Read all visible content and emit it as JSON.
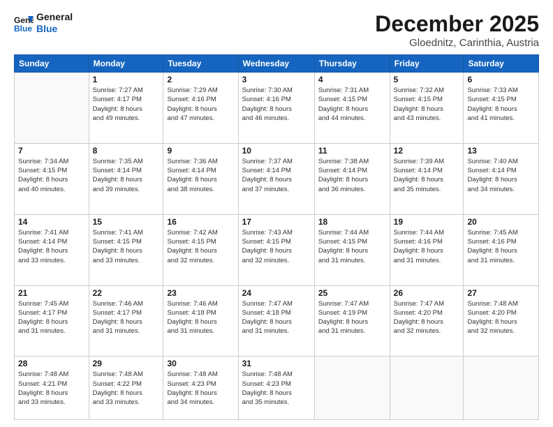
{
  "header": {
    "logo_line1": "General",
    "logo_line2": "Blue",
    "month": "December 2025",
    "location": "Gloednitz, Carinthia, Austria"
  },
  "weekdays": [
    "Sunday",
    "Monday",
    "Tuesday",
    "Wednesday",
    "Thursday",
    "Friday",
    "Saturday"
  ],
  "weeks": [
    [
      {
        "day": "",
        "info": ""
      },
      {
        "day": "1",
        "info": "Sunrise: 7:27 AM\nSunset: 4:17 PM\nDaylight: 8 hours\nand 49 minutes."
      },
      {
        "day": "2",
        "info": "Sunrise: 7:29 AM\nSunset: 4:16 PM\nDaylight: 8 hours\nand 47 minutes."
      },
      {
        "day": "3",
        "info": "Sunrise: 7:30 AM\nSunset: 4:16 PM\nDaylight: 8 hours\nand 46 minutes."
      },
      {
        "day": "4",
        "info": "Sunrise: 7:31 AM\nSunset: 4:15 PM\nDaylight: 8 hours\nand 44 minutes."
      },
      {
        "day": "5",
        "info": "Sunrise: 7:32 AM\nSunset: 4:15 PM\nDaylight: 8 hours\nand 43 minutes."
      },
      {
        "day": "6",
        "info": "Sunrise: 7:33 AM\nSunset: 4:15 PM\nDaylight: 8 hours\nand 41 minutes."
      }
    ],
    [
      {
        "day": "7",
        "info": "Sunrise: 7:34 AM\nSunset: 4:15 PM\nDaylight: 8 hours\nand 40 minutes."
      },
      {
        "day": "8",
        "info": "Sunrise: 7:35 AM\nSunset: 4:14 PM\nDaylight: 8 hours\nand 39 minutes."
      },
      {
        "day": "9",
        "info": "Sunrise: 7:36 AM\nSunset: 4:14 PM\nDaylight: 8 hours\nand 38 minutes."
      },
      {
        "day": "10",
        "info": "Sunrise: 7:37 AM\nSunset: 4:14 PM\nDaylight: 8 hours\nand 37 minutes."
      },
      {
        "day": "11",
        "info": "Sunrise: 7:38 AM\nSunset: 4:14 PM\nDaylight: 8 hours\nand 36 minutes."
      },
      {
        "day": "12",
        "info": "Sunrise: 7:39 AM\nSunset: 4:14 PM\nDaylight: 8 hours\nand 35 minutes."
      },
      {
        "day": "13",
        "info": "Sunrise: 7:40 AM\nSunset: 4:14 PM\nDaylight: 8 hours\nand 34 minutes."
      }
    ],
    [
      {
        "day": "14",
        "info": "Sunrise: 7:41 AM\nSunset: 4:14 PM\nDaylight: 8 hours\nand 33 minutes."
      },
      {
        "day": "15",
        "info": "Sunrise: 7:41 AM\nSunset: 4:15 PM\nDaylight: 8 hours\nand 33 minutes."
      },
      {
        "day": "16",
        "info": "Sunrise: 7:42 AM\nSunset: 4:15 PM\nDaylight: 8 hours\nand 32 minutes."
      },
      {
        "day": "17",
        "info": "Sunrise: 7:43 AM\nSunset: 4:15 PM\nDaylight: 8 hours\nand 32 minutes."
      },
      {
        "day": "18",
        "info": "Sunrise: 7:44 AM\nSunset: 4:15 PM\nDaylight: 8 hours\nand 31 minutes."
      },
      {
        "day": "19",
        "info": "Sunrise: 7:44 AM\nSunset: 4:16 PM\nDaylight: 8 hours\nand 31 minutes."
      },
      {
        "day": "20",
        "info": "Sunrise: 7:45 AM\nSunset: 4:16 PM\nDaylight: 8 hours\nand 31 minutes."
      }
    ],
    [
      {
        "day": "21",
        "info": "Sunrise: 7:45 AM\nSunset: 4:17 PM\nDaylight: 8 hours\nand 31 minutes."
      },
      {
        "day": "22",
        "info": "Sunrise: 7:46 AM\nSunset: 4:17 PM\nDaylight: 8 hours\nand 31 minutes."
      },
      {
        "day": "23",
        "info": "Sunrise: 7:46 AM\nSunset: 4:18 PM\nDaylight: 8 hours\nand 31 minutes."
      },
      {
        "day": "24",
        "info": "Sunrise: 7:47 AM\nSunset: 4:18 PM\nDaylight: 8 hours\nand 31 minutes."
      },
      {
        "day": "25",
        "info": "Sunrise: 7:47 AM\nSunset: 4:19 PM\nDaylight: 8 hours\nand 31 minutes."
      },
      {
        "day": "26",
        "info": "Sunrise: 7:47 AM\nSunset: 4:20 PM\nDaylight: 8 hours\nand 32 minutes."
      },
      {
        "day": "27",
        "info": "Sunrise: 7:48 AM\nSunset: 4:20 PM\nDaylight: 8 hours\nand 32 minutes."
      }
    ],
    [
      {
        "day": "28",
        "info": "Sunrise: 7:48 AM\nSunset: 4:21 PM\nDaylight: 8 hours\nand 33 minutes."
      },
      {
        "day": "29",
        "info": "Sunrise: 7:48 AM\nSunset: 4:22 PM\nDaylight: 8 hours\nand 33 minutes."
      },
      {
        "day": "30",
        "info": "Sunrise: 7:48 AM\nSunset: 4:23 PM\nDaylight: 8 hours\nand 34 minutes."
      },
      {
        "day": "31",
        "info": "Sunrise: 7:48 AM\nSunset: 4:23 PM\nDaylight: 8 hours\nand 35 minutes."
      },
      {
        "day": "",
        "info": ""
      },
      {
        "day": "",
        "info": ""
      },
      {
        "day": "",
        "info": ""
      }
    ]
  ]
}
